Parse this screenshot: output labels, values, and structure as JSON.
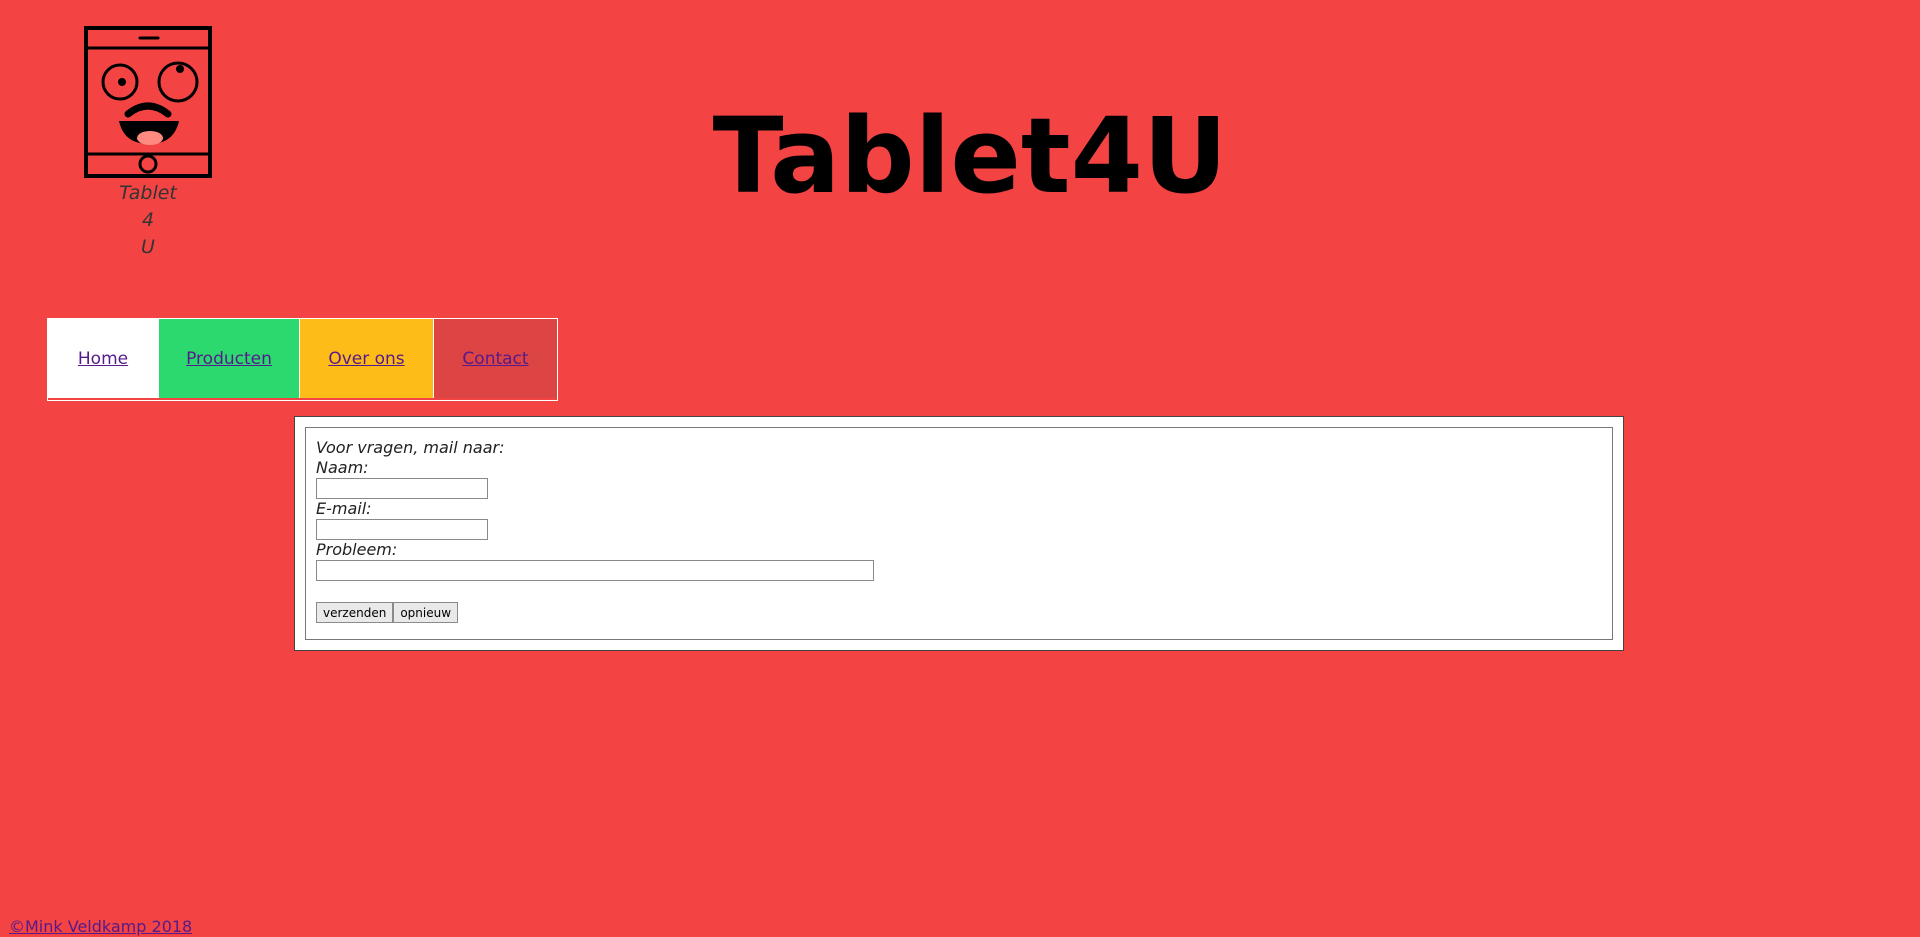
{
  "header": {
    "title": "Tablet4U",
    "logo_icon": "tablet-face-icon",
    "logo_caption": [
      "Tablet",
      "4",
      "U"
    ]
  },
  "nav": {
    "items": [
      {
        "label": "Home",
        "color": "#ffffff"
      },
      {
        "label": "Producten",
        "color": "#2bd96e"
      },
      {
        "label": "Over ons",
        "color": "#fdbc17"
      },
      {
        "label": "Contact",
        "color": "#dd4444"
      }
    ]
  },
  "contact_form": {
    "intro": "Voor vragen, mail naar:",
    "name_label": "Naam:",
    "name_value": "",
    "email_label": "E-mail:",
    "email_value": "",
    "problem_label": "Probleem:",
    "problem_value": "",
    "submit_label": "verzenden",
    "reset_label": "opnieuw"
  },
  "footer": {
    "copyright": "©Mink Veldkamp 2018"
  },
  "colors": {
    "page_background": "#f44343",
    "link": "#551a8b"
  }
}
